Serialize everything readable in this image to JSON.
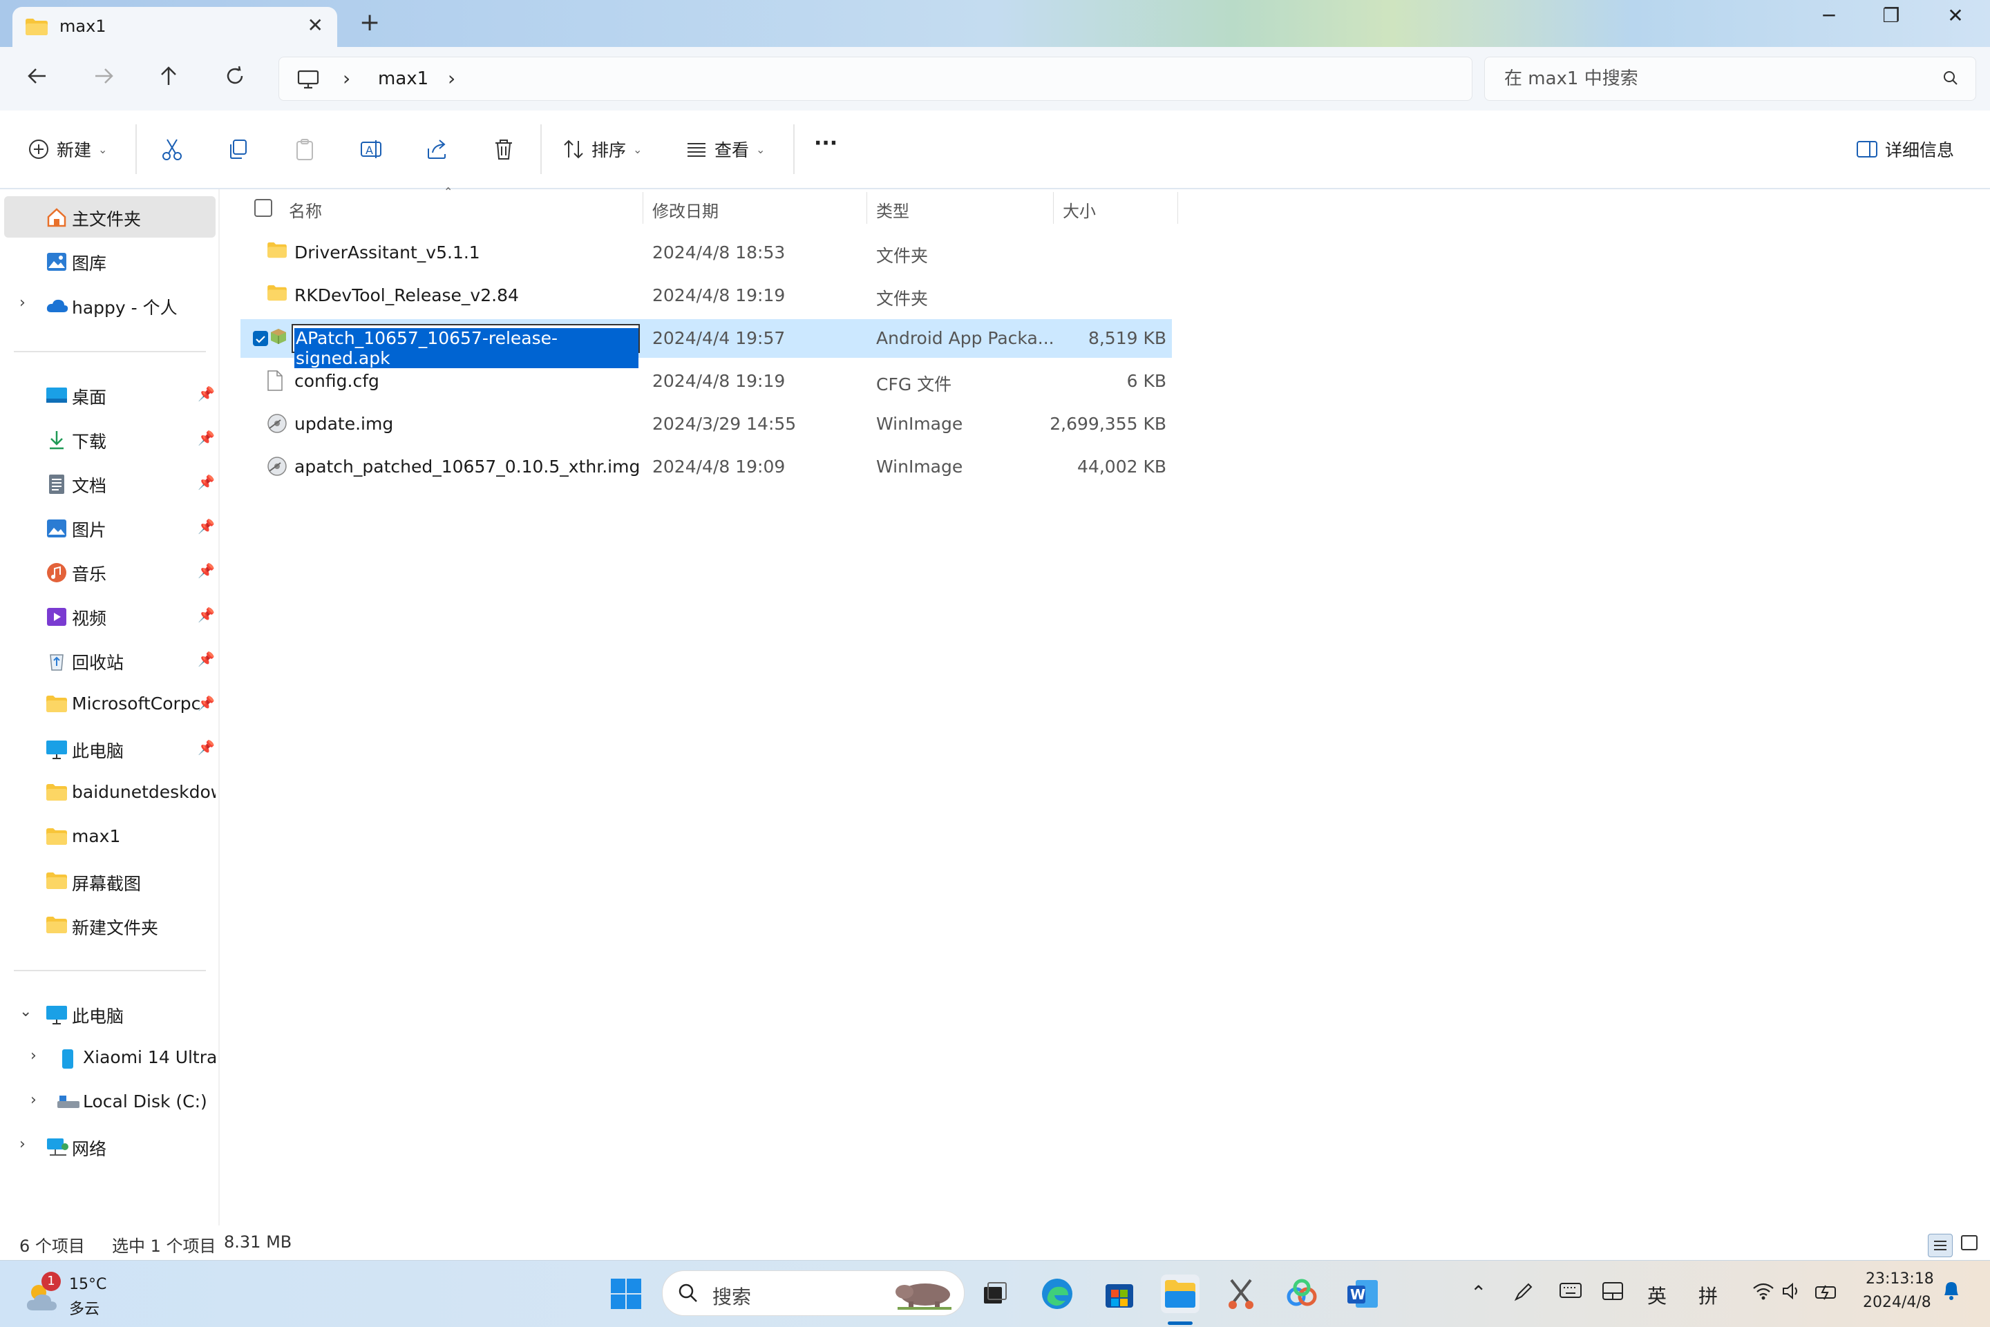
{
  "window": {
    "tab_title": "max1",
    "new_tab": "+",
    "close_tab": "✕",
    "minimize": "─",
    "restore": "❐",
    "close": "✕"
  },
  "address": {
    "crumb": "max1",
    "search_placeholder": "在 max1 中搜索"
  },
  "toolbar": {
    "new_label": "新建",
    "sort_label": "排序",
    "view_label": "查看",
    "more": "···",
    "details_label": "详细信息"
  },
  "sidebar": {
    "top": [
      {
        "label": "主文件夹",
        "icon": "home-icon"
      },
      {
        "label": "图库",
        "icon": "gallery-icon"
      },
      {
        "label": "happy - 个人",
        "icon": "onedrive-icon"
      }
    ],
    "pinned": [
      {
        "label": "桌面",
        "icon": "desktop-icon"
      },
      {
        "label": "下载",
        "icon": "download-icon"
      },
      {
        "label": "文档",
        "icon": "documents-icon"
      },
      {
        "label": "图片",
        "icon": "pictures-icon"
      },
      {
        "label": "音乐",
        "icon": "music-icon"
      },
      {
        "label": "视频",
        "icon": "videos-icon"
      },
      {
        "label": "回收站",
        "icon": "recycle-bin-icon"
      },
      {
        "label": "MicrosoftCorpc",
        "icon": "folder-icon"
      },
      {
        "label": "此电脑",
        "icon": "computer-icon"
      },
      {
        "label": "baidunetdeskdow",
        "icon": "folder-icon"
      },
      {
        "label": "max1",
        "icon": "folder-icon"
      },
      {
        "label": "屏幕截图",
        "icon": "folder-icon"
      },
      {
        "label": "新建文件夹",
        "icon": "folder-icon"
      }
    ],
    "tree": [
      {
        "label": "此电脑",
        "icon": "computer-icon"
      },
      {
        "label": "Xiaomi 14 Ultra",
        "icon": "phone-icon"
      },
      {
        "label": "Local Disk (C:)",
        "icon": "drive-icon"
      },
      {
        "label": "网络",
        "icon": "network-icon"
      }
    ]
  },
  "columns": {
    "name": "名称",
    "date": "修改日期",
    "type": "类型",
    "size": "大小"
  },
  "files": [
    {
      "name": "DriverAssitant_v5.1.1",
      "date": "2024/4/8 18:53",
      "type": "文件夹",
      "size": "",
      "icon": "folder-icon"
    },
    {
      "name": "RKDevTool_Release_v2.84",
      "date": "2024/4/8 19:19",
      "type": "文件夹",
      "size": "",
      "icon": "folder-icon"
    },
    {
      "name": "APatch_10657_10657-release-signed.apk",
      "date": "2024/4/4 19:57",
      "type": "Android App Packa...",
      "size": "8,519 KB",
      "icon": "apk-package-icon",
      "selected": true
    },
    {
      "name": "config.cfg",
      "date": "2024/4/8 19:19",
      "type": "CFG 文件",
      "size": "6 KB",
      "icon": "file-icon"
    },
    {
      "name": "update.img",
      "date": "2024/3/29 14:55",
      "type": "WinImage",
      "size": "2,699,355 KB",
      "icon": "disk-image-icon"
    },
    {
      "name": "apatch_patched_10657_0.10.5_xthr.img",
      "date": "2024/4/8 19:09",
      "type": "WinImage",
      "size": "44,002 KB",
      "icon": "disk-image-icon"
    }
  ],
  "status": {
    "count": "6 个项目",
    "selection": "选中 1 个项目",
    "size": "8.31 MB"
  },
  "taskbar": {
    "weather_temp": "15°C",
    "weather_desc": "多云",
    "weather_badge": "1",
    "search_placeholder": "搜索",
    "ime_lang": "英",
    "ime_mode": "拼",
    "time": "23:13:18",
    "date": "2024/4/8"
  },
  "colors": {
    "accent": "#0067c0",
    "selection": "#cce8ff",
    "folder": "#f8c53a"
  }
}
